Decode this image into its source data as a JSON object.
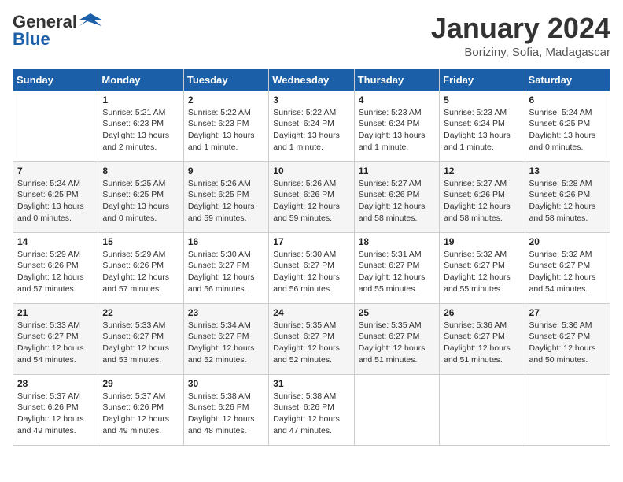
{
  "header": {
    "logo_line1": "General",
    "logo_line2": "Blue",
    "month": "January 2024",
    "location": "Boriziny, Sofia, Madagascar"
  },
  "days_of_week": [
    "Sunday",
    "Monday",
    "Tuesday",
    "Wednesday",
    "Thursday",
    "Friday",
    "Saturday"
  ],
  "weeks": [
    [
      {
        "num": "",
        "detail": ""
      },
      {
        "num": "1",
        "detail": "Sunrise: 5:21 AM\nSunset: 6:23 PM\nDaylight: 13 hours\nand 2 minutes."
      },
      {
        "num": "2",
        "detail": "Sunrise: 5:22 AM\nSunset: 6:23 PM\nDaylight: 13 hours\nand 1 minute."
      },
      {
        "num": "3",
        "detail": "Sunrise: 5:22 AM\nSunset: 6:24 PM\nDaylight: 13 hours\nand 1 minute."
      },
      {
        "num": "4",
        "detail": "Sunrise: 5:23 AM\nSunset: 6:24 PM\nDaylight: 13 hours\nand 1 minute."
      },
      {
        "num": "5",
        "detail": "Sunrise: 5:23 AM\nSunset: 6:24 PM\nDaylight: 13 hours\nand 1 minute."
      },
      {
        "num": "6",
        "detail": "Sunrise: 5:24 AM\nSunset: 6:25 PM\nDaylight: 13 hours\nand 0 minutes."
      }
    ],
    [
      {
        "num": "7",
        "detail": "Sunrise: 5:24 AM\nSunset: 6:25 PM\nDaylight: 13 hours\nand 0 minutes."
      },
      {
        "num": "8",
        "detail": "Sunrise: 5:25 AM\nSunset: 6:25 PM\nDaylight: 13 hours\nand 0 minutes."
      },
      {
        "num": "9",
        "detail": "Sunrise: 5:26 AM\nSunset: 6:25 PM\nDaylight: 12 hours\nand 59 minutes."
      },
      {
        "num": "10",
        "detail": "Sunrise: 5:26 AM\nSunset: 6:26 PM\nDaylight: 12 hours\nand 59 minutes."
      },
      {
        "num": "11",
        "detail": "Sunrise: 5:27 AM\nSunset: 6:26 PM\nDaylight: 12 hours\nand 58 minutes."
      },
      {
        "num": "12",
        "detail": "Sunrise: 5:27 AM\nSunset: 6:26 PM\nDaylight: 12 hours\nand 58 minutes."
      },
      {
        "num": "13",
        "detail": "Sunrise: 5:28 AM\nSunset: 6:26 PM\nDaylight: 12 hours\nand 58 minutes."
      }
    ],
    [
      {
        "num": "14",
        "detail": "Sunrise: 5:29 AM\nSunset: 6:26 PM\nDaylight: 12 hours\nand 57 minutes."
      },
      {
        "num": "15",
        "detail": "Sunrise: 5:29 AM\nSunset: 6:26 PM\nDaylight: 12 hours\nand 57 minutes."
      },
      {
        "num": "16",
        "detail": "Sunrise: 5:30 AM\nSunset: 6:27 PM\nDaylight: 12 hours\nand 56 minutes."
      },
      {
        "num": "17",
        "detail": "Sunrise: 5:30 AM\nSunset: 6:27 PM\nDaylight: 12 hours\nand 56 minutes."
      },
      {
        "num": "18",
        "detail": "Sunrise: 5:31 AM\nSunset: 6:27 PM\nDaylight: 12 hours\nand 55 minutes."
      },
      {
        "num": "19",
        "detail": "Sunrise: 5:32 AM\nSunset: 6:27 PM\nDaylight: 12 hours\nand 55 minutes."
      },
      {
        "num": "20",
        "detail": "Sunrise: 5:32 AM\nSunset: 6:27 PM\nDaylight: 12 hours\nand 54 minutes."
      }
    ],
    [
      {
        "num": "21",
        "detail": "Sunrise: 5:33 AM\nSunset: 6:27 PM\nDaylight: 12 hours\nand 54 minutes."
      },
      {
        "num": "22",
        "detail": "Sunrise: 5:33 AM\nSunset: 6:27 PM\nDaylight: 12 hours\nand 53 minutes."
      },
      {
        "num": "23",
        "detail": "Sunrise: 5:34 AM\nSunset: 6:27 PM\nDaylight: 12 hours\nand 52 minutes."
      },
      {
        "num": "24",
        "detail": "Sunrise: 5:35 AM\nSunset: 6:27 PM\nDaylight: 12 hours\nand 52 minutes."
      },
      {
        "num": "25",
        "detail": "Sunrise: 5:35 AM\nSunset: 6:27 PM\nDaylight: 12 hours\nand 51 minutes."
      },
      {
        "num": "26",
        "detail": "Sunrise: 5:36 AM\nSunset: 6:27 PM\nDaylight: 12 hours\nand 51 minutes."
      },
      {
        "num": "27",
        "detail": "Sunrise: 5:36 AM\nSunset: 6:27 PM\nDaylight: 12 hours\nand 50 minutes."
      }
    ],
    [
      {
        "num": "28",
        "detail": "Sunrise: 5:37 AM\nSunset: 6:26 PM\nDaylight: 12 hours\nand 49 minutes."
      },
      {
        "num": "29",
        "detail": "Sunrise: 5:37 AM\nSunset: 6:26 PM\nDaylight: 12 hours\nand 49 minutes."
      },
      {
        "num": "30",
        "detail": "Sunrise: 5:38 AM\nSunset: 6:26 PM\nDaylight: 12 hours\nand 48 minutes."
      },
      {
        "num": "31",
        "detail": "Sunrise: 5:38 AM\nSunset: 6:26 PM\nDaylight: 12 hours\nand 47 minutes."
      },
      {
        "num": "",
        "detail": ""
      },
      {
        "num": "",
        "detail": ""
      },
      {
        "num": "",
        "detail": ""
      }
    ]
  ]
}
